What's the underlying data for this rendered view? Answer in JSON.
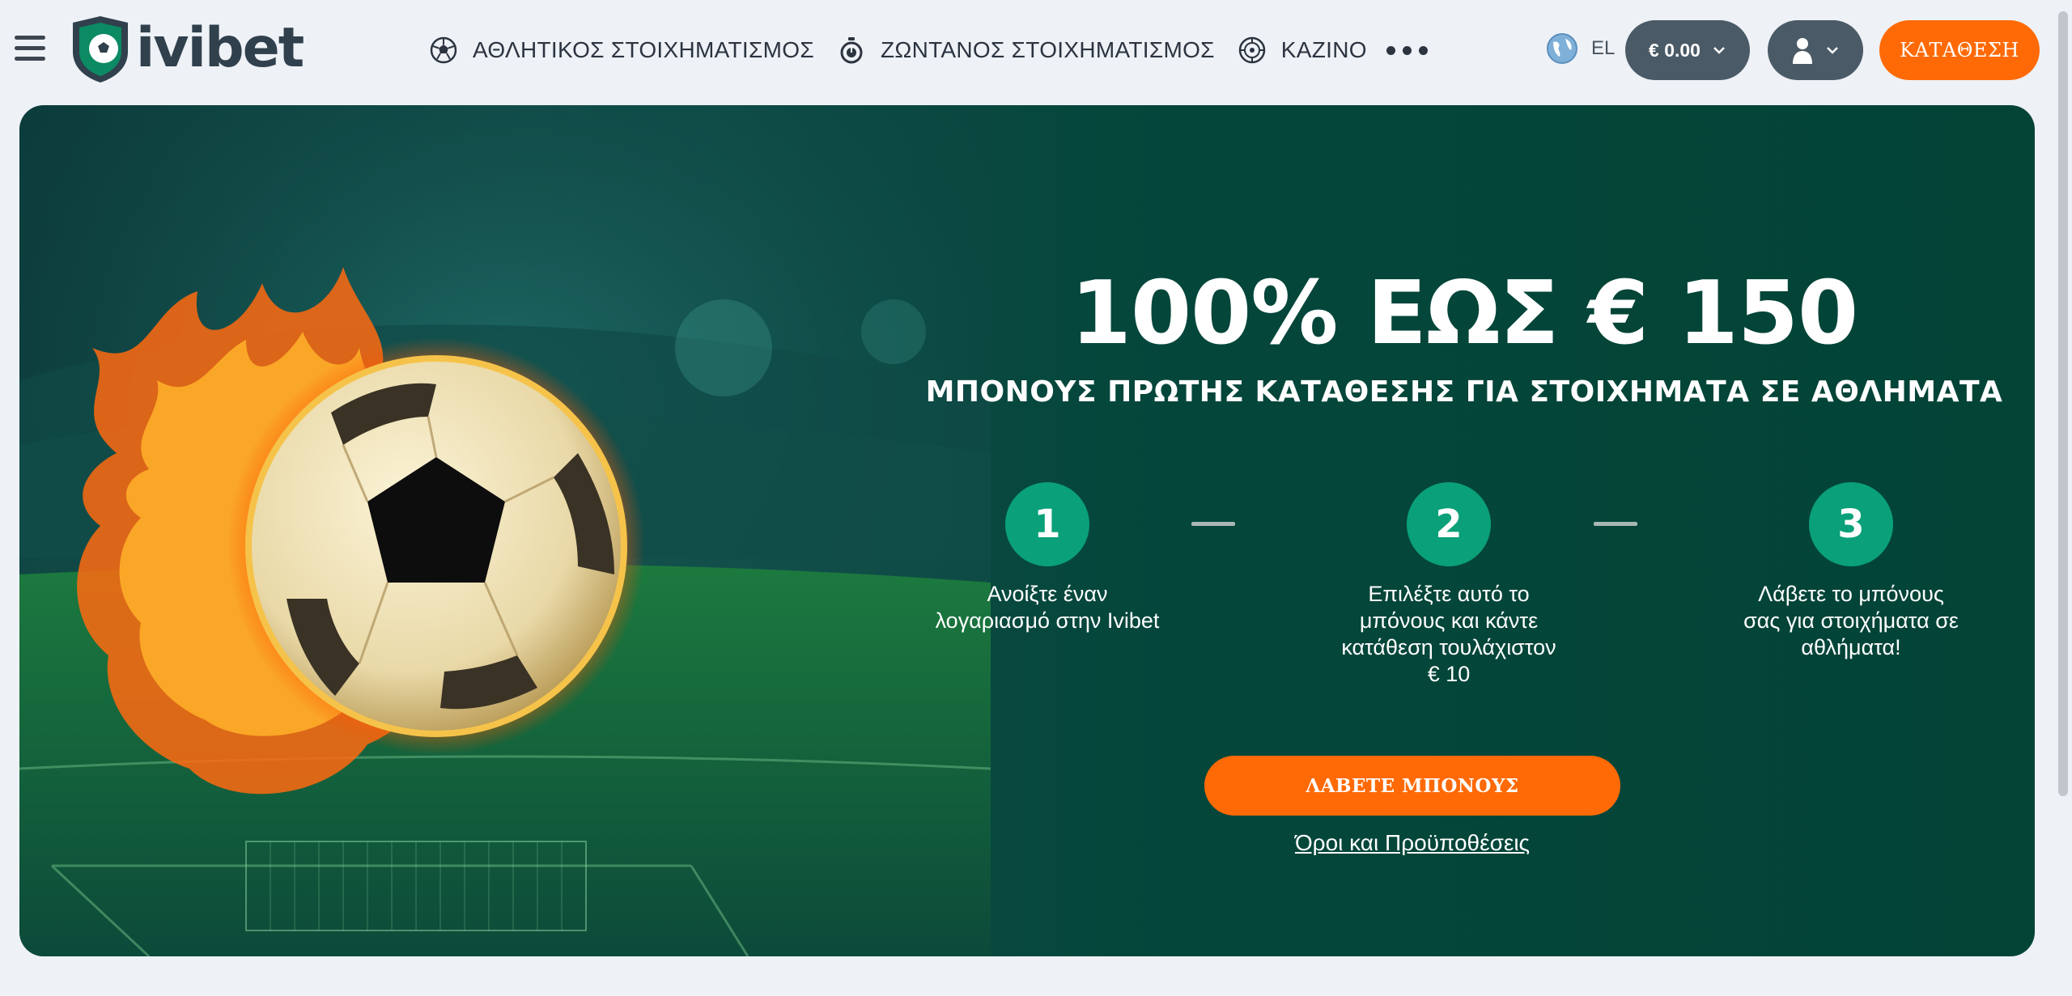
{
  "header": {
    "logo_text": "ivibet",
    "nav": [
      {
        "label": "ΑΘΛΗΤΙΚΟΣ ΣΤΟΙΧΗΜΑΤΙΣΜΟΣ",
        "icon": "soccer-ball-icon"
      },
      {
        "label": "ΖΩΝΤΑΝΟΣ ΣΤΟΙΧΗΜΑΤΙΣΜΟΣ",
        "icon": "stopwatch-icon"
      },
      {
        "label": "ΚΑΖΙΝΟ",
        "icon": "roulette-icon"
      }
    ],
    "more_icon": "more-dots-icon",
    "language": "EL",
    "balance": "€ 0.00",
    "deposit_label": "ΚΑΤΑΘΕΣΗ"
  },
  "banner": {
    "headline": "100% ΕΩΣ € 150",
    "subheadline": "ΜΠΟΝΟΥΣ ΠΡΩΤΗΣ ΚΑΤΑΘΕΣΗΣ ΓΙΑ ΣΤΟΙΧΗΜΑΤΑ ΣΕ ΑΘΛΗΜΑΤΑ",
    "steps": [
      {
        "number": "1",
        "text": "Ανοίξτε έναν λογαριασμό στην Ivibet"
      },
      {
        "number": "2",
        "text": "Επιλέξτε αυτό το μπόνους και κάντε κατάθεση τουλάχιστον € 10"
      },
      {
        "number": "3",
        "text": "Λάβετε το μπόνους σας για στοιχήματα σε αθλήματα!"
      }
    ],
    "cta_label": "ΛΑΒΕΤΕ ΜΠΟΝΟΥΣ",
    "terms_label": "Όροι και Προϋποθέσεις"
  },
  "colors": {
    "accent_orange": "#ff6a06",
    "step_green": "#0aa07a",
    "banner_bg": "#04463a",
    "header_pill": "#4a5a66"
  }
}
